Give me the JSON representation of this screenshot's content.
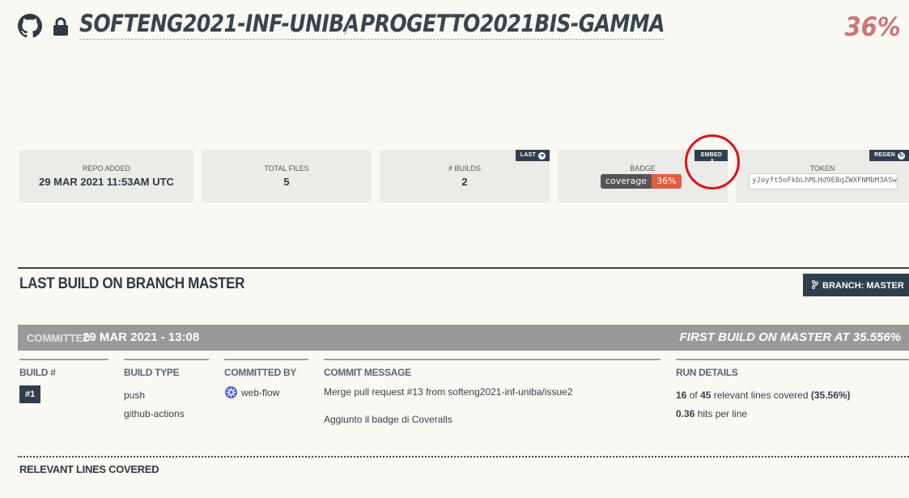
{
  "header": {
    "owner": "SOFTENG2021-INF-UNIBA",
    "separator": "/",
    "repo": "PROGETTO2021BIS-GAMMA",
    "coverage": "36%"
  },
  "stats": {
    "repo_added_label": "REPO ADDED",
    "repo_added_value": "29 MAR 2021 11:53AM UTC",
    "total_files_label": "TOTAL FILES",
    "total_files_value": "5",
    "builds_label": "# BUILDS",
    "builds_value": "2",
    "builds_tag": "LAST",
    "badge_label": "BADGE",
    "badge_tag": "EMBED",
    "badge_left": "coverage",
    "badge_right": "36%",
    "token_label": "TOKEN",
    "token_tag": "REGEN",
    "token_value": "yJoyft5oFkbLhMLHd9EBqZWXFNMbM3ASw"
  },
  "build": {
    "section_title": "LAST BUILD ON BRANCH MASTER",
    "branch_button": "BRANCH: MASTER",
    "committed_label": "COMMITTED",
    "committed_value": "29 MAR 2021 - 13:08",
    "first_build": "FIRST BUILD ON MASTER AT 35.556%",
    "build_no_label": "BUILD #",
    "build_no_value": "#1",
    "build_type_label": "BUILD TYPE",
    "build_type_1": "push",
    "build_type_2": "github-actions",
    "committed_by_label": "COMMITTED BY",
    "committed_by_value": "web-flow",
    "commit_message_label": "COMMIT MESSAGE",
    "commit_message_1": "Merge pull request #13 from softeng2021-inf-uniba/issue2",
    "commit_message_2": "Aggiunto il badge di Coveralls",
    "run_details_label": "RUN DETAILS",
    "run_covered": "16",
    "run_of": "of",
    "run_total": "45",
    "run_text": "relevant lines covered",
    "run_pct": "(35.56%)",
    "hits_value": "0.36",
    "hits_text": "hits per line",
    "relevant_lines_title": "RELEVANT LINES COVERED"
  },
  "colors": {
    "accent": "#2f3f4d",
    "coverage": "#c9777a",
    "badge_red": "#e05d44",
    "annotation": "#e0101a"
  }
}
